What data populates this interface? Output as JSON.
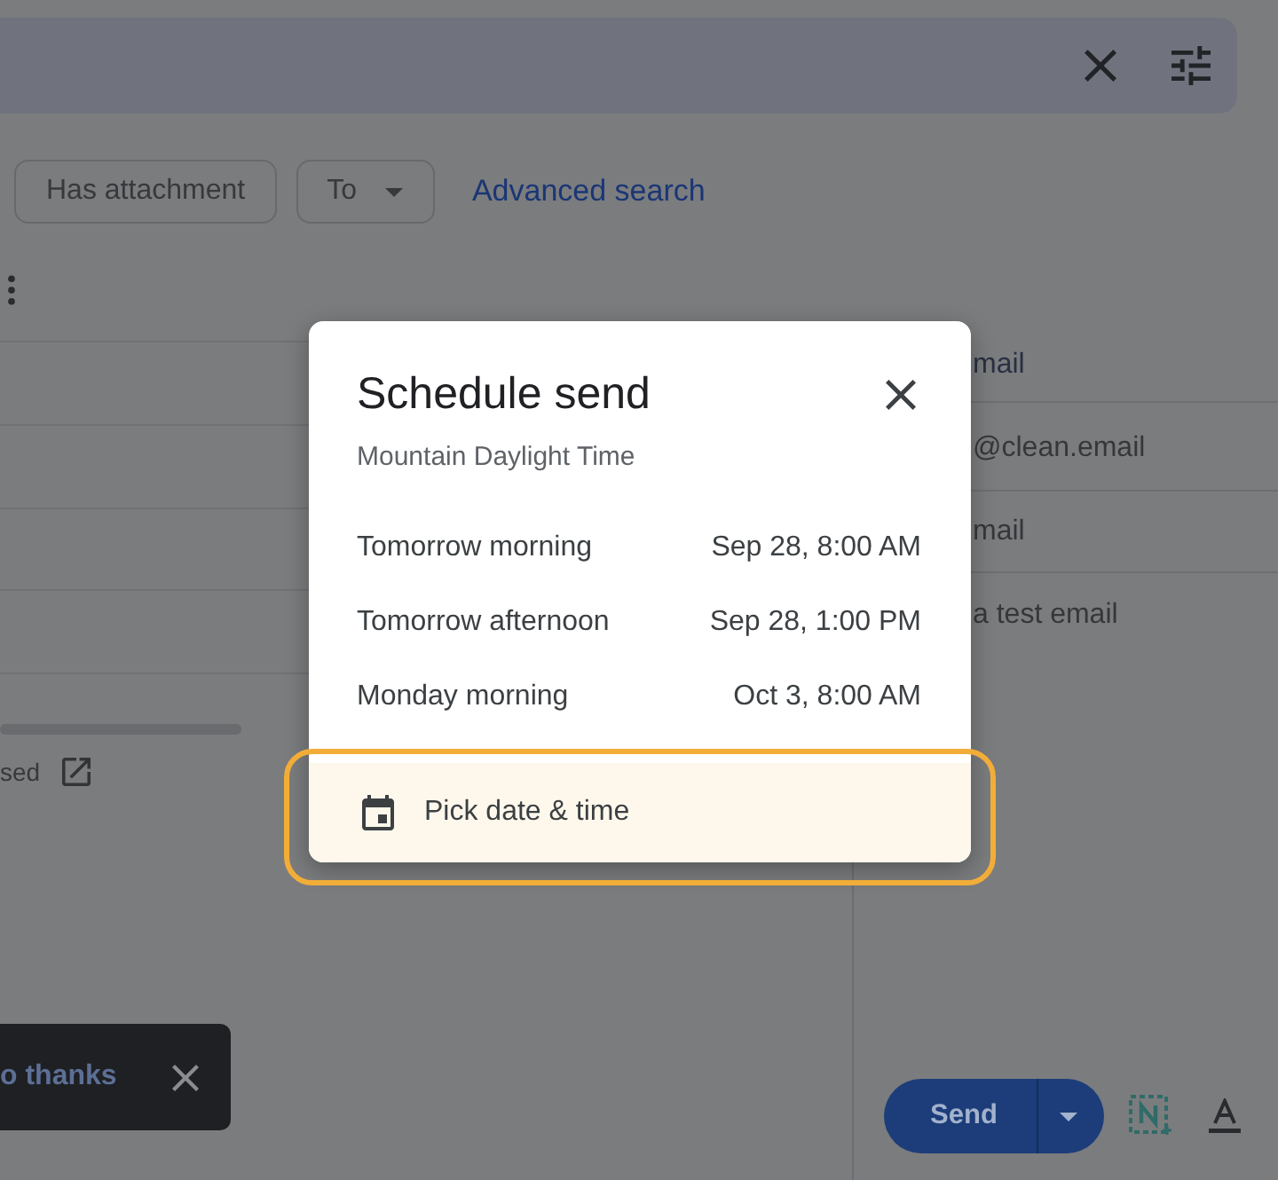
{
  "filters": {
    "chips": [
      {
        "label": "Has attachment",
        "kind": "toggle"
      },
      {
        "label": "To",
        "kind": "dropdown"
      }
    ],
    "link": "Advanced search"
  },
  "storage": {
    "text": "sed"
  },
  "compose": {
    "rows": [
      {
        "kind": "header",
        "text": "mail"
      },
      {
        "kind": "recipients",
        "text": "@clean.email"
      },
      {
        "kind": "subject",
        "text": "mail"
      },
      {
        "kind": "body",
        "text": "a test email"
      }
    ],
    "send_label": "Send"
  },
  "snackbar": {
    "action": "o thanks"
  },
  "dialog": {
    "title": "Schedule send",
    "timezone": "Mountain Daylight Time",
    "options": [
      {
        "label": "Tomorrow morning",
        "time": "Sep 28, 8:00 AM"
      },
      {
        "label": "Tomorrow afternoon",
        "time": "Sep 28, 1:00 PM"
      },
      {
        "label": "Monday morning",
        "time": "Oct 3, 8:00 AM"
      }
    ],
    "custom": {
      "label": "Pick date & time",
      "highlighted": true
    }
  }
}
